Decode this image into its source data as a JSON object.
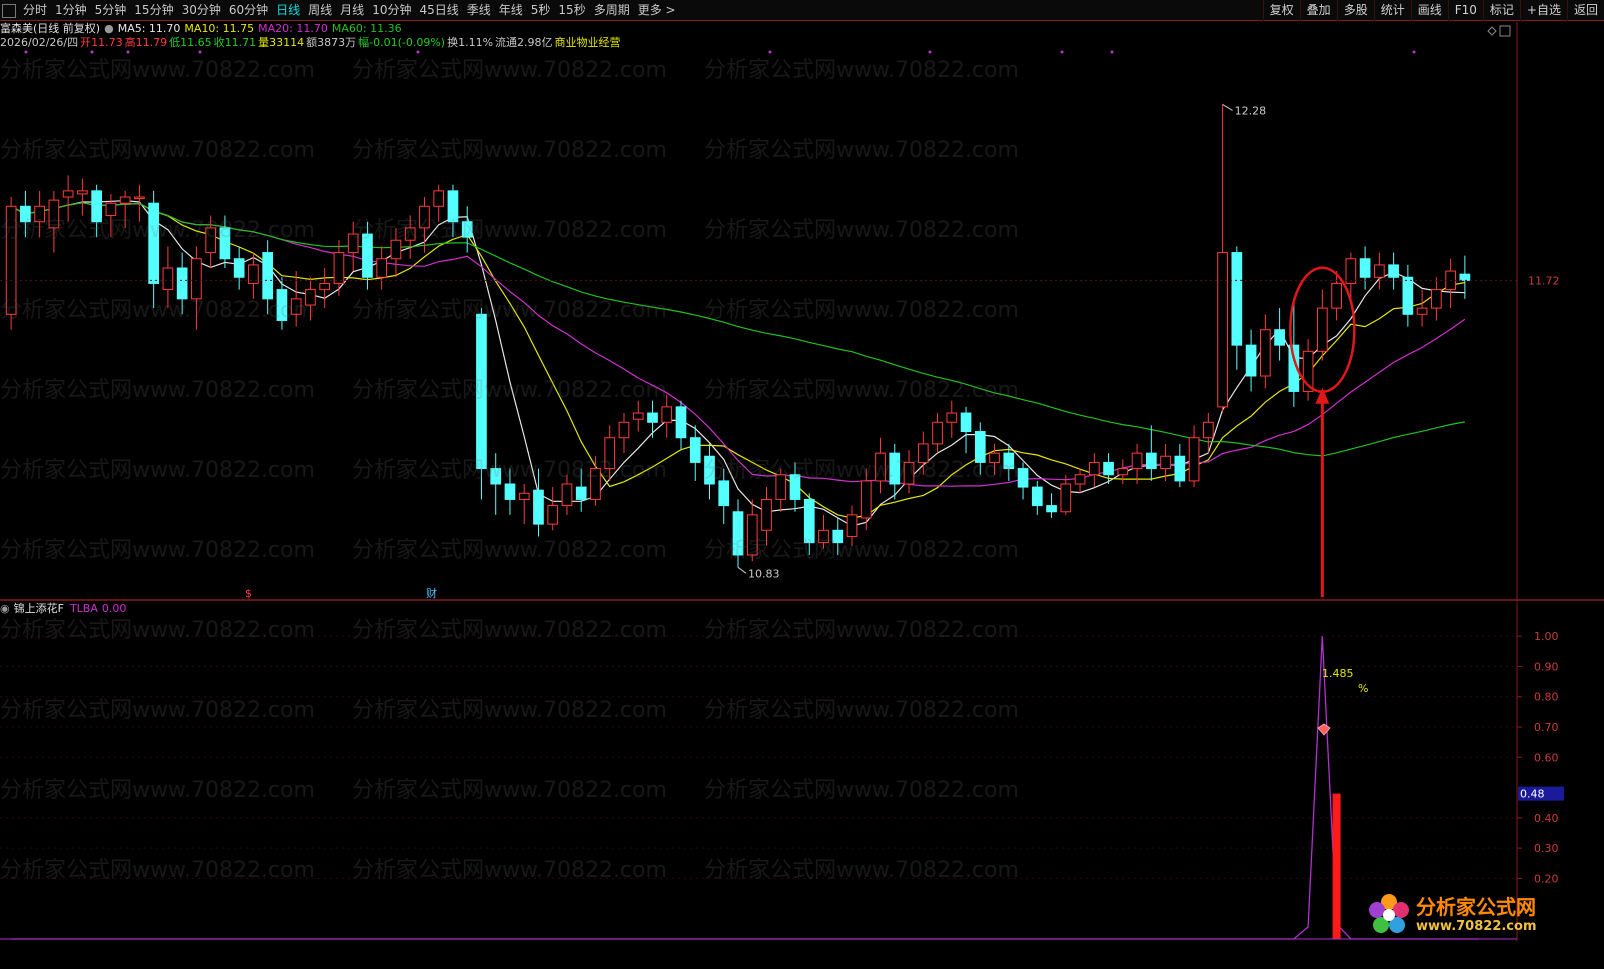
{
  "toolbar": {
    "periods": [
      "分时",
      "1分钟",
      "5分钟",
      "15分钟",
      "30分钟",
      "60分钟",
      "日线",
      "周线",
      "月线",
      "10分钟",
      "45日线",
      "季线",
      "年线",
      "5秒",
      "15秒",
      "多周期",
      "更多 >"
    ],
    "active_period": "日线",
    "right_buttons": [
      "复权",
      "叠加",
      "多股",
      "统计",
      "画线",
      "F10",
      "标记",
      "+自选",
      "返回"
    ]
  },
  "stock": {
    "title": "富森美(日线 前复权)",
    "ma5": "MA5: 11.70",
    "ma10": "MA10: 11.75",
    "ma20": "MA20: 11.70",
    "ma60": "MA60: 11.36",
    "date": "2026/02/26/四",
    "open": "开11.73",
    "high": "高11.79",
    "low": "低11.65",
    "close": "收11.71",
    "volume": "量33114",
    "amount": "额3873万",
    "change": "幅-0.01(-0.09%)",
    "turnover": "换1.11%",
    "float": "流通2.98亿",
    "business": "商业物业经营"
  },
  "price_axis": {
    "current_price_label": "11.72",
    "high_marker": "12.28",
    "low_marker": "10.83",
    "event_markers": [
      "$",
      "财"
    ]
  },
  "indicator": {
    "name": "锦上添花F",
    "series_label": "TLBA",
    "series_value": "0.00",
    "y_ticks": [
      "1.00",
      "0.90",
      "0.80",
      "0.70",
      "0.60",
      "0.40",
      "0.30",
      "0.20"
    ],
    "current_value_label": "0.48",
    "annotation_value": "1.485",
    "annotation_unit": "%"
  },
  "watermark": "分析家公式网www.70822.com",
  "logo": {
    "name": "分析家公式网",
    "url": "www.70822.com"
  },
  "colors": {
    "up": "#ff3b3b",
    "down": "#54ffff",
    "ma5": "#e6e6e6",
    "ma10": "#e6e600",
    "ma20": "#d030d0",
    "ma60": "#20c020",
    "accent_circle": "#e01818",
    "indicator_line": "#b030d0"
  },
  "chart_data": {
    "type": "candlestick",
    "y_range": [
      10.7,
      12.45
    ],
    "candles": [
      [
        11.6,
        11.95,
        11.55,
        11.98
      ],
      [
        11.95,
        11.9,
        11.85,
        12.0
      ],
      [
        11.9,
        11.95,
        11.85,
        12.0
      ],
      [
        11.88,
        11.97,
        11.8,
        12.0
      ],
      [
        11.98,
        12.0,
        11.9,
        12.05
      ],
      [
        11.99,
        12.0,
        11.92,
        12.04
      ],
      [
        12.0,
        11.9,
        11.85,
        12.02
      ],
      [
        11.92,
        11.96,
        11.85,
        11.99
      ],
      [
        11.96,
        11.98,
        11.88,
        12.0
      ],
      [
        11.98,
        11.98,
        11.9,
        12.02
      ],
      [
        11.96,
        11.7,
        11.62,
        12.0
      ],
      [
        11.68,
        11.75,
        11.62,
        11.82
      ],
      [
        11.75,
        11.65,
        11.6,
        11.8
      ],
      [
        11.65,
        11.78,
        11.55,
        11.82
      ],
      [
        11.8,
        11.88,
        11.75,
        11.92
      ],
      [
        11.88,
        11.78,
        11.75,
        11.92
      ],
      [
        11.78,
        11.72,
        11.68,
        11.82
      ],
      [
        11.7,
        11.76,
        11.65,
        11.8
      ],
      [
        11.8,
        11.65,
        11.6,
        11.84
      ],
      [
        11.68,
        11.58,
        11.55,
        11.72
      ],
      [
        11.6,
        11.65,
        11.56,
        11.74
      ],
      [
        11.63,
        11.68,
        11.58,
        11.72
      ],
      [
        11.68,
        11.7,
        11.62,
        11.75
      ],
      [
        11.7,
        11.8,
        11.66,
        11.84
      ],
      [
        11.8,
        11.86,
        11.74,
        11.9
      ],
      [
        11.86,
        11.72,
        11.68,
        11.9
      ],
      [
        11.72,
        11.78,
        11.68,
        11.82
      ],
      [
        11.78,
        11.84,
        11.72,
        11.88
      ],
      [
        11.84,
        11.88,
        11.78,
        11.92
      ],
      [
        11.88,
        11.95,
        11.8,
        11.98
      ],
      [
        11.95,
        12.0,
        11.9,
        12.02
      ],
      [
        12.0,
        11.9,
        11.85,
        12.02
      ],
      [
        11.9,
        11.85,
        11.8,
        11.95
      ],
      [
        11.6,
        11.1,
        11.0,
        11.62
      ],
      [
        11.1,
        11.05,
        10.95,
        11.15
      ],
      [
        11.05,
        11.0,
        10.95,
        11.1
      ],
      [
        11.0,
        11.02,
        10.92,
        11.05
      ],
      [
        11.03,
        10.92,
        10.88,
        11.1
      ],
      [
        10.92,
        10.98,
        10.9,
        11.04
      ],
      [
        10.98,
        11.05,
        10.95,
        11.08
      ],
      [
        11.04,
        11.0,
        10.96,
        11.1
      ],
      [
        11.0,
        11.1,
        10.98,
        11.14
      ],
      [
        11.1,
        11.2,
        11.06,
        11.24
      ],
      [
        11.2,
        11.25,
        11.15,
        11.28
      ],
      [
        11.26,
        11.28,
        11.22,
        11.32
      ],
      [
        11.28,
        11.25,
        11.2,
        11.32
      ],
      [
        11.25,
        11.3,
        11.2,
        11.34
      ],
      [
        11.3,
        11.2,
        11.16,
        11.32
      ],
      [
        11.2,
        11.12,
        11.06,
        11.24
      ],
      [
        11.14,
        11.05,
        11.0,
        11.18
      ],
      [
        11.06,
        10.98,
        10.92,
        11.1
      ],
      [
        10.96,
        10.82,
        10.78,
        11.0
      ],
      [
        10.82,
        10.95,
        10.8,
        11.0
      ],
      [
        10.9,
        11.0,
        10.85,
        11.04
      ],
      [
        11.0,
        11.08,
        10.96,
        11.1
      ],
      [
        11.08,
        11.0,
        10.96,
        11.12
      ],
      [
        11.0,
        10.86,
        10.82,
        11.02
      ],
      [
        10.86,
        10.9,
        10.84,
        10.95
      ],
      [
        10.9,
        10.86,
        10.82,
        10.94
      ],
      [
        10.88,
        10.95,
        10.85,
        10.98
      ],
      [
        10.94,
        11.06,
        10.9,
        11.1
      ],
      [
        11.06,
        11.15,
        11.02,
        11.2
      ],
      [
        11.15,
        11.05,
        11.0,
        11.18
      ],
      [
        11.05,
        11.12,
        11.02,
        11.16
      ],
      [
        11.12,
        11.18,
        11.08,
        11.22
      ],
      [
        11.18,
        11.25,
        11.15,
        11.28
      ],
      [
        11.25,
        11.28,
        11.2,
        11.32
      ],
      [
        11.28,
        11.22,
        11.15,
        11.3
      ],
      [
        11.22,
        11.12,
        11.08,
        11.25
      ],
      [
        11.12,
        11.15,
        11.08,
        11.18
      ],
      [
        11.15,
        11.1,
        11.06,
        11.18
      ],
      [
        11.1,
        11.04,
        11.0,
        11.12
      ],
      [
        11.04,
        10.98,
        10.95,
        11.06
      ],
      [
        10.98,
        10.96,
        10.94,
        11.02
      ],
      [
        10.96,
        11.05,
        10.95,
        11.08
      ],
      [
        11.05,
        11.08,
        11.02,
        11.1
      ],
      [
        11.08,
        11.12,
        11.04,
        11.15
      ],
      [
        11.12,
        11.08,
        11.05,
        11.15
      ],
      [
        11.08,
        11.1,
        11.05,
        11.13
      ],
      [
        11.1,
        11.15,
        11.05,
        11.18
      ],
      [
        11.15,
        11.1,
        11.06,
        11.24
      ],
      [
        11.1,
        11.14,
        11.06,
        11.18
      ],
      [
        11.14,
        11.06,
        11.04,
        11.18
      ],
      [
        11.06,
        11.2,
        11.04,
        11.24
      ],
      [
        11.2,
        11.25,
        11.15,
        11.28
      ],
      [
        11.3,
        11.8,
        11.28,
        12.28
      ],
      [
        11.8,
        11.5,
        11.42,
        11.82
      ],
      [
        11.5,
        11.4,
        11.35,
        11.55
      ],
      [
        11.4,
        11.55,
        11.36,
        11.6
      ],
      [
        11.55,
        11.5,
        11.45,
        11.62
      ],
      [
        11.5,
        11.35,
        11.3,
        11.65
      ],
      [
        11.35,
        11.48,
        11.32,
        11.52
      ],
      [
        11.48,
        11.62,
        11.45,
        11.68
      ],
      [
        11.62,
        11.7,
        11.58,
        11.74
      ],
      [
        11.7,
        11.78,
        11.65,
        11.8
      ],
      [
        11.78,
        11.72,
        11.68,
        11.82
      ],
      [
        11.72,
        11.76,
        11.68,
        11.8
      ],
      [
        11.76,
        11.72,
        11.68,
        11.8
      ],
      [
        11.72,
        11.6,
        11.56,
        11.76
      ],
      [
        11.6,
        11.62,
        11.56,
        11.68
      ],
      [
        11.62,
        11.68,
        11.58,
        11.72
      ],
      [
        11.68,
        11.74,
        11.62,
        11.78
      ],
      [
        11.73,
        11.71,
        11.65,
        11.79
      ]
    ],
    "indicator_values": [
      0,
      0,
      0,
      0,
      0,
      0,
      0,
      0,
      0,
      0,
      0,
      0,
      0,
      0,
      0,
      0,
      0,
      0,
      0,
      0,
      0,
      0,
      0,
      0,
      0,
      0,
      0,
      0,
      0,
      0,
      0,
      0,
      0,
      0,
      0,
      0,
      0,
      0,
      0,
      0,
      0,
      0,
      0,
      0,
      0,
      0,
      0,
      0,
      0,
      0,
      0,
      0,
      0,
      0,
      0,
      0,
      0,
      0,
      0,
      0,
      0,
      0,
      0,
      0,
      0,
      0,
      0,
      0,
      0,
      0,
      0,
      0,
      0,
      0,
      0,
      0,
      0,
      0,
      0,
      0,
      0,
      0,
      0,
      0,
      0,
      0,
      0,
      0,
      0,
      0,
      0,
      0.04,
      1.0,
      0.05,
      0,
      0,
      0,
      0,
      0,
      0,
      0,
      0,
      0,
      0
    ],
    "indicator_bar_index": 92,
    "indicator_bar_value": 0.48,
    "indicator_range": [
      0,
      1.05
    ]
  }
}
